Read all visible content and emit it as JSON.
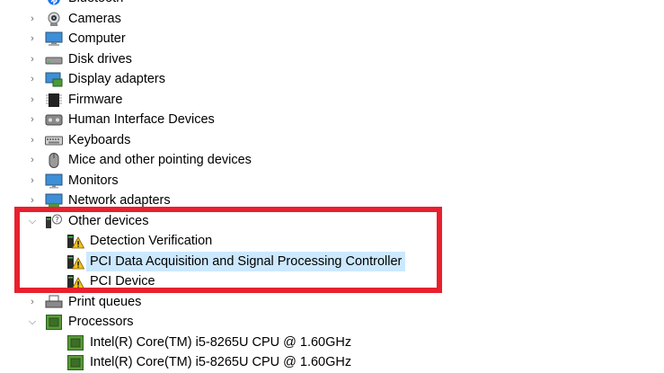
{
  "device_tree": {
    "items": [
      {
        "label": "Bluetooth",
        "icon": "bluetooth-icon",
        "level": 0,
        "expanded": false
      },
      {
        "label": "Cameras",
        "icon": "camera-icon",
        "level": 0,
        "expanded": false
      },
      {
        "label": "Computer",
        "icon": "computer-icon",
        "level": 0,
        "expanded": false
      },
      {
        "label": "Disk drives",
        "icon": "disk-drive-icon",
        "level": 0,
        "expanded": false
      },
      {
        "label": "Display adapters",
        "icon": "display-adapter-icon",
        "level": 0,
        "expanded": false
      },
      {
        "label": "Firmware",
        "icon": "firmware-icon",
        "level": 0,
        "expanded": false
      },
      {
        "label": "Human Interface Devices",
        "icon": "hid-icon",
        "level": 0,
        "expanded": false
      },
      {
        "label": "Keyboards",
        "icon": "keyboard-icon",
        "level": 0,
        "expanded": false
      },
      {
        "label": "Mice and other pointing devices",
        "icon": "mouse-icon",
        "level": 0,
        "expanded": false
      },
      {
        "label": "Monitors",
        "icon": "monitor-icon",
        "level": 0,
        "expanded": false
      },
      {
        "label": "Network adapters",
        "icon": "network-adapter-icon",
        "level": 0,
        "expanded": false
      },
      {
        "label": "Other devices",
        "icon": "unknown-device-icon",
        "level": 0,
        "expanded": true
      },
      {
        "label": "Detection Verification",
        "icon": "warning-device-icon",
        "level": 1
      },
      {
        "label": "PCI Data Acquisition and Signal Processing Controller",
        "icon": "warning-device-icon",
        "level": 1,
        "selected": true
      },
      {
        "label": "PCI Device",
        "icon": "warning-device-icon",
        "level": 1
      },
      {
        "label": "Print queues",
        "icon": "printer-icon",
        "level": 0,
        "expanded": false
      },
      {
        "label": "Processors",
        "icon": "processor-icon",
        "level": 0,
        "expanded": true
      },
      {
        "label": "Intel(R) Core(TM) i5-8265U CPU @ 1.60GHz",
        "icon": "processor-icon",
        "level": 1
      },
      {
        "label": "Intel(R) Core(TM) i5-8265U CPU @ 1.60GHz",
        "icon": "processor-icon",
        "level": 1
      }
    ]
  },
  "colors": {
    "highlight_border": "#e8202e",
    "selection_bg": "#cce8ff",
    "chevron": "#6b6b6b"
  }
}
